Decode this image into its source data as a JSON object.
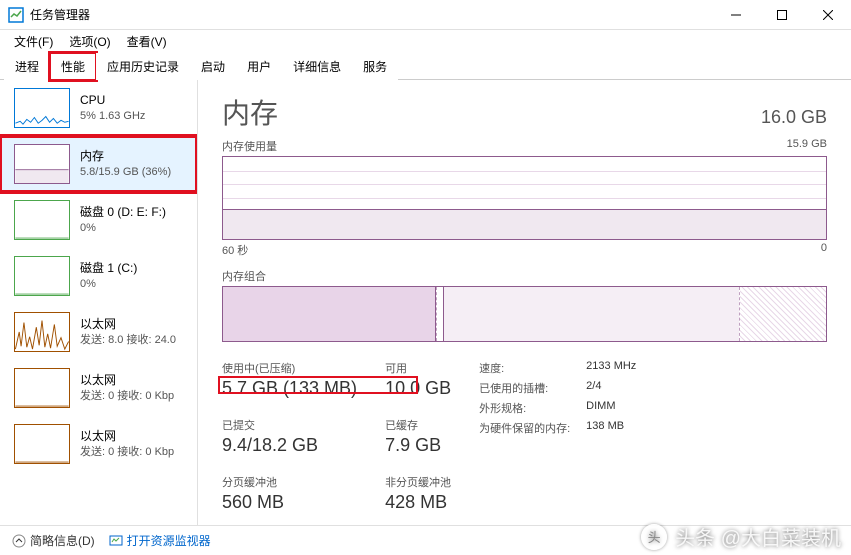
{
  "window": {
    "title": "任务管理器"
  },
  "menu": {
    "file": "文件(F)",
    "options": "选项(O)",
    "view": "查看(V)"
  },
  "tabs": {
    "processes": "进程",
    "performance": "性能",
    "app_history": "应用历史记录",
    "startup": "启动",
    "users": "用户",
    "details": "详细信息",
    "services": "服务"
  },
  "sidebar": [
    {
      "title": "CPU",
      "sub": "5% 1.63 GHz",
      "color": "#0078d7",
      "type": "cpu"
    },
    {
      "title": "内存",
      "sub": "5.8/15.9 GB (36%)",
      "color": "#8d5a8d",
      "type": "memory",
      "selected": true,
      "highlight": true
    },
    {
      "title": "磁盘 0 (D: E: F:)",
      "sub": "0%",
      "color": "#4ca64c",
      "type": "disk"
    },
    {
      "title": "磁盘 1 (C:)",
      "sub": "0%",
      "color": "#4ca64c",
      "type": "disk"
    },
    {
      "title": "以太网",
      "sub": "发送: 8.0 接收: 24.0",
      "color": "#a05000",
      "type": "net-active"
    },
    {
      "title": "以太网",
      "sub": "发送: 0 接收: 0 Kbp",
      "color": "#a05000",
      "type": "net"
    },
    {
      "title": "以太网",
      "sub": "发送: 0 接收: 0 Kbp",
      "color": "#a05000",
      "type": "net"
    }
  ],
  "main": {
    "title": "内存",
    "capacity": "16.0 GB",
    "usage_label": "内存使用量",
    "usage_max": "15.9 GB",
    "axis_left": "60 秒",
    "axis_right": "0",
    "comp_label": "内存组合"
  },
  "stats": {
    "in_use_label": "使用中(已压缩)",
    "in_use_value": "5.7 GB (133 MB)",
    "available_label": "可用",
    "available_value": "10.0 GB",
    "committed_label": "已提交",
    "committed_value": "9.4/18.2 GB",
    "cached_label": "已缓存",
    "cached_value": "7.9 GB",
    "paged_label": "分页缓冲池",
    "paged_value": "560 MB",
    "nonpaged_label": "非分页缓冲池",
    "nonpaged_value": "428 MB"
  },
  "details": {
    "speed_label": "速度:",
    "speed_value": "2133 MHz",
    "slots_label": "已使用的插槽:",
    "slots_value": "2/4",
    "form_label": "外形规格:",
    "form_value": "DIMM",
    "reserved_label": "为硬件保留的内存:",
    "reserved_value": "138 MB"
  },
  "footer": {
    "fewer": "简略信息(D)",
    "resmon": "打开资源监视器"
  },
  "watermark": "头条 @大白菜装机",
  "chart_data": {
    "type": "line",
    "title": "内存使用量",
    "xlabel": "60 秒",
    "ylabel": "GB",
    "ylim": [
      0,
      15.9
    ],
    "x": [
      60,
      50,
      40,
      30,
      20,
      10,
      0
    ],
    "series": [
      {
        "name": "使用中",
        "values": [
          5.7,
          5.7,
          5.7,
          5.7,
          5.7,
          5.7,
          5.7
        ]
      }
    ],
    "composition": {
      "in_use_gb": 5.7,
      "modified_gb": 0.0,
      "standby_gb": 7.9,
      "free_gb": 2.3,
      "total_gb": 15.9
    }
  }
}
